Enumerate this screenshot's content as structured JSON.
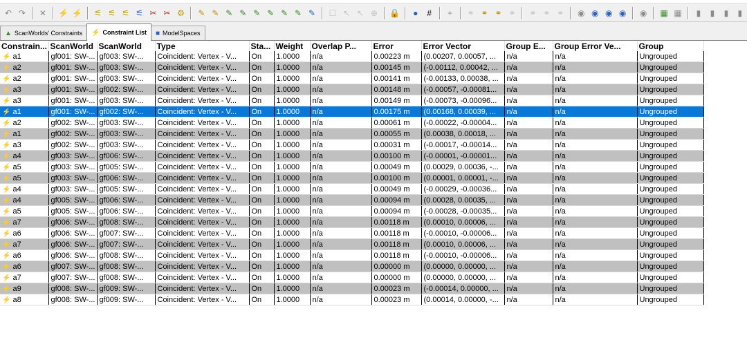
{
  "tabs": [
    {
      "label": "ScanWorlds' Constraints",
      "icon": "scanworld-icon"
    },
    {
      "label": "Constraint List",
      "icon": "constraint-list-icon"
    },
    {
      "label": "ModelSpaces",
      "icon": "modelspace-icon"
    }
  ],
  "columns": [
    "Constrain...",
    "ScanWorld",
    "ScanWorld",
    "Type",
    "Sta...",
    "Weight",
    "Overlap P...",
    "Error",
    "Error Vector",
    "Group E...",
    "Group Error Ve...",
    "Group"
  ],
  "rows": [
    [
      "a1",
      "gf001: SW-...",
      "gf003: SW-...",
      "Coincident: Vertex - V...",
      "On",
      "1.0000",
      "n/a",
      "0.00223 m",
      "(0.00207, 0.00057, ...",
      "n/a",
      "n/a",
      "Ungrouped"
    ],
    [
      "a2",
      "gf001: SW-...",
      "gf003: SW-...",
      "Coincident: Vertex - V...",
      "On",
      "1.0000",
      "n/a",
      "0.00145 m",
      "(-0.00112, 0.00042, ...",
      "n/a",
      "n/a",
      "Ungrouped"
    ],
    [
      "a2",
      "gf001: SW-...",
      "gf003: SW-...",
      "Coincident: Vertex - V...",
      "On",
      "1.0000",
      "n/a",
      "0.00141 m",
      "(-0.00133, 0.00038, ...",
      "n/a",
      "n/a",
      "Ungrouped"
    ],
    [
      "a3",
      "gf001: SW-...",
      "gf002: SW-...",
      "Coincident: Vertex - V...",
      "On",
      "1.0000",
      "n/a",
      "0.00148 m",
      "(-0.00057, -0.00081...",
      "n/a",
      "n/a",
      "Ungrouped"
    ],
    [
      "a3",
      "gf001: SW-...",
      "gf003: SW-...",
      "Coincident: Vertex - V...",
      "On",
      "1.0000",
      "n/a",
      "0.00149 m",
      "(-0.00073, -0.00096...",
      "n/a",
      "n/a",
      "Ungrouped"
    ],
    [
      "a1",
      "gf001: SW-...",
      "gf002: SW-...",
      "Coincident: Vertex - V...",
      "On",
      "1.0000",
      "n/a",
      "0.00175 m",
      "(0.00168, 0.00039, ...",
      "n/a",
      "n/a",
      "Ungrouped"
    ],
    [
      "a2",
      "gf002: SW-...",
      "gf003: SW-...",
      "Coincident: Vertex - V...",
      "On",
      "1.0000",
      "n/a",
      "0.00061 m",
      "(-0.00022, -0.00004...",
      "n/a",
      "n/a",
      "Ungrouped"
    ],
    [
      "a1",
      "gf002: SW-...",
      "gf003: SW-...",
      "Coincident: Vertex - V...",
      "On",
      "1.0000",
      "n/a",
      "0.00055 m",
      "(0.00038, 0.00018, ...",
      "n/a",
      "n/a",
      "Ungrouped"
    ],
    [
      "a3",
      "gf002: SW-...",
      "gf003: SW-...",
      "Coincident: Vertex - V...",
      "On",
      "1.0000",
      "n/a",
      "0.00031 m",
      "(-0.00017, -0.00014...",
      "n/a",
      "n/a",
      "Ungrouped"
    ],
    [
      "a4",
      "gf003: SW-...",
      "gf006: SW-...",
      "Coincident: Vertex - V...",
      "On",
      "1.0000",
      "n/a",
      "0.00100 m",
      "(-0.00001, -0.00001...",
      "n/a",
      "n/a",
      "Ungrouped"
    ],
    [
      "a5",
      "gf003: SW-...",
      "gf005: SW-...",
      "Coincident: Vertex - V...",
      "On",
      "1.0000",
      "n/a",
      "0.00049 m",
      "(0.00029, 0.00036, -...",
      "n/a",
      "n/a",
      "Ungrouped"
    ],
    [
      "a5",
      "gf003: SW-...",
      "gf006: SW-...",
      "Coincident: Vertex - V...",
      "On",
      "1.0000",
      "n/a",
      "0.00100 m",
      "(0.00001, 0.00001, -...",
      "n/a",
      "n/a",
      "Ungrouped"
    ],
    [
      "a4",
      "gf003: SW-...",
      "gf005: SW-...",
      "Coincident: Vertex - V...",
      "On",
      "1.0000",
      "n/a",
      "0.00049 m",
      "(-0.00029, -0.00036...",
      "n/a",
      "n/a",
      "Ungrouped"
    ],
    [
      "a4",
      "gf005: SW-...",
      "gf006: SW-...",
      "Coincident: Vertex - V...",
      "On",
      "1.0000",
      "n/a",
      "0.00094 m",
      "(0.00028, 0.00035, ...",
      "n/a",
      "n/a",
      "Ungrouped"
    ],
    [
      "a5",
      "gf005: SW-...",
      "gf006: SW-...",
      "Coincident: Vertex - V...",
      "On",
      "1.0000",
      "n/a",
      "0.00094 m",
      "(-0.00028, -0.00035...",
      "n/a",
      "n/a",
      "Ungrouped"
    ],
    [
      "a7",
      "gf006: SW-...",
      "gf008: SW-...",
      "Coincident: Vertex - V...",
      "On",
      "1.0000",
      "n/a",
      "0.00118 m",
      "(0.00010, 0.00006, ...",
      "n/a",
      "n/a",
      "Ungrouped"
    ],
    [
      "a6",
      "gf006: SW-...",
      "gf007: SW-...",
      "Coincident: Vertex - V...",
      "On",
      "1.0000",
      "n/a",
      "0.00118 m",
      "(-0.00010, -0.00006...",
      "n/a",
      "n/a",
      "Ungrouped"
    ],
    [
      "a7",
      "gf006: SW-...",
      "gf007: SW-...",
      "Coincident: Vertex - V...",
      "On",
      "1.0000",
      "n/a",
      "0.00118 m",
      "(0.00010, 0.00006, ...",
      "n/a",
      "n/a",
      "Ungrouped"
    ],
    [
      "a6",
      "gf006: SW-...",
      "gf008: SW-...",
      "Coincident: Vertex - V...",
      "On",
      "1.0000",
      "n/a",
      "0.00118 m",
      "(-0.00010, -0.00006...",
      "n/a",
      "n/a",
      "Ungrouped"
    ],
    [
      "a6",
      "gf007: SW-...",
      "gf008: SW-...",
      "Coincident: Vertex - V...",
      "On",
      "1.0000",
      "n/a",
      "0.00000 m",
      "(0.00000, 0.00000, ...",
      "n/a",
      "n/a",
      "Ungrouped"
    ],
    [
      "a7",
      "gf007: SW-...",
      "gf008: SW-...",
      "Coincident: Vertex - V...",
      "On",
      "1.0000",
      "n/a",
      "0.00000 m",
      "(0.00000, 0.00000, ...",
      "n/a",
      "n/a",
      "Ungrouped"
    ],
    [
      "a9",
      "gf008: SW-...",
      "gf009: SW-...",
      "Coincident: Vertex - V...",
      "On",
      "1.0000",
      "n/a",
      "0.00023 m",
      "(-0.00014, 0.00000, ...",
      "n/a",
      "n/a",
      "Ungrouped"
    ],
    [
      "a8",
      "gf008: SW-...",
      "gf009: SW-...",
      "Coincident: Vertex - V...",
      "On",
      "1.0000",
      "n/a",
      "0.00023 m",
      "(0.00014, 0.00000, -...",
      "n/a",
      "n/a",
      "Ungrouped"
    ]
  ],
  "selected_row": 5,
  "colors": {
    "selected": "#0a78d7",
    "alt_row": "#c0c0c0",
    "constraint_icon": "#c8a000"
  }
}
